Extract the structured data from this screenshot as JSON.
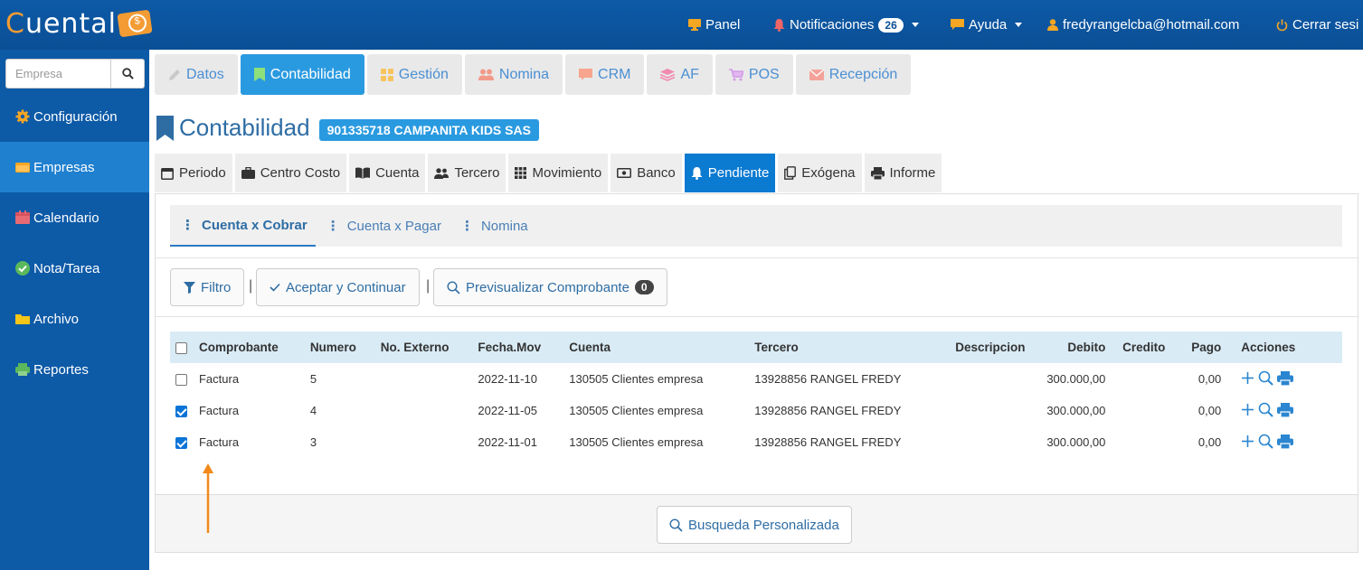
{
  "brand": {
    "logo_text": "Cuental",
    "logo_first": "C",
    "logo_rest": "uental"
  },
  "topnav": {
    "panel": "Panel",
    "notificaciones": "Notificaciones",
    "notif_count": "26",
    "ayuda": "Ayuda",
    "user": "fredyrangelcba@hotmail.com",
    "cerrar": "Cerrar sesi"
  },
  "sidebar": {
    "search_placeholder": "Empresa",
    "items": [
      {
        "label": "Configuración",
        "icon": "gear-icon"
      },
      {
        "label": "Empresas",
        "icon": "folder-icon",
        "active": true
      },
      {
        "label": "Calendario",
        "icon": "calendar-icon"
      },
      {
        "label": "Nota/Tarea",
        "icon": "check-circle-icon"
      },
      {
        "label": "Archivo",
        "icon": "folder-icon"
      },
      {
        "label": "Reportes",
        "icon": "print-icon"
      }
    ]
  },
  "modules": [
    {
      "label": "Datos",
      "icon": "pencil-icon"
    },
    {
      "label": "Contabilidad",
      "icon": "bookmark-icon",
      "active": true
    },
    {
      "label": "Gestión",
      "icon": "grid-icon"
    },
    {
      "label": "Nomina",
      "icon": "users-icon"
    },
    {
      "label": "CRM",
      "icon": "comment-icon"
    },
    {
      "label": "AF",
      "icon": "layers-icon"
    },
    {
      "label": "POS",
      "icon": "cart-icon"
    },
    {
      "label": "Recepción",
      "icon": "envelope-icon"
    }
  ],
  "page": {
    "title": "Contabilidad",
    "company": "901335718 CAMPANITA KIDS SAS"
  },
  "section_tabs": [
    {
      "label": "Periodo",
      "icon": "calendar-icon"
    },
    {
      "label": "Centro Costo",
      "icon": "briefcase-icon"
    },
    {
      "label": "Cuenta",
      "icon": "book-icon"
    },
    {
      "label": "Tercero",
      "icon": "users-icon"
    },
    {
      "label": "Movimiento",
      "icon": "grid-icon"
    },
    {
      "label": "Banco",
      "icon": "money-icon"
    },
    {
      "label": "Pendiente",
      "icon": "bell-icon",
      "active": true
    },
    {
      "label": "Exógena",
      "icon": "copy-icon"
    },
    {
      "label": "Informe",
      "icon": "print-icon"
    }
  ],
  "sub_tabs": [
    {
      "label": "Cuenta x Cobrar",
      "active": true
    },
    {
      "label": "Cuenta x Pagar"
    },
    {
      "label": "Nomina"
    }
  ],
  "toolbar": {
    "filtro": "Filtro",
    "aceptar": "Aceptar y Continuar",
    "previsualizar": "Previsualizar Comprobante",
    "preview_count": "0",
    "sep": "|"
  },
  "table": {
    "headers": [
      "Comprobante",
      "Numero",
      "No. Externo",
      "Fecha.Mov",
      "Cuenta",
      "Tercero",
      "Descripcion",
      "Debito",
      "Credito",
      "Pago",
      "Acciones"
    ],
    "rows": [
      {
        "checked": false,
        "comprobante": "Factura",
        "numero": "5",
        "externo": "",
        "fecha": "2022-11-10",
        "cuenta": "130505 Clientes empresa",
        "tercero": "13928856 RANGEL FREDY",
        "descripcion": "",
        "debito": "300.000,00",
        "credito": "",
        "pago": "0,00"
      },
      {
        "checked": true,
        "comprobante": "Factura",
        "numero": "4",
        "externo": "",
        "fecha": "2022-11-05",
        "cuenta": "130505 Clientes empresa",
        "tercero": "13928856 RANGEL FREDY",
        "descripcion": "",
        "debito": "300.000,00",
        "credito": "",
        "pago": "0,00"
      },
      {
        "checked": true,
        "comprobante": "Factura",
        "numero": "3",
        "externo": "",
        "fecha": "2022-11-01",
        "cuenta": "130505 Clientes empresa",
        "tercero": "13928856 RANGEL FREDY",
        "descripcion": "",
        "debito": "300.000,00",
        "credito": "",
        "pago": "0,00"
      }
    ]
  },
  "footer": {
    "busqueda": "Busqueda Personalizada"
  },
  "colors": {
    "accent": "#2a9ae0",
    "sidebar": "#0d5aa7",
    "topbar": "#0a4f96",
    "annotation_arrow": "#f28a1b"
  }
}
